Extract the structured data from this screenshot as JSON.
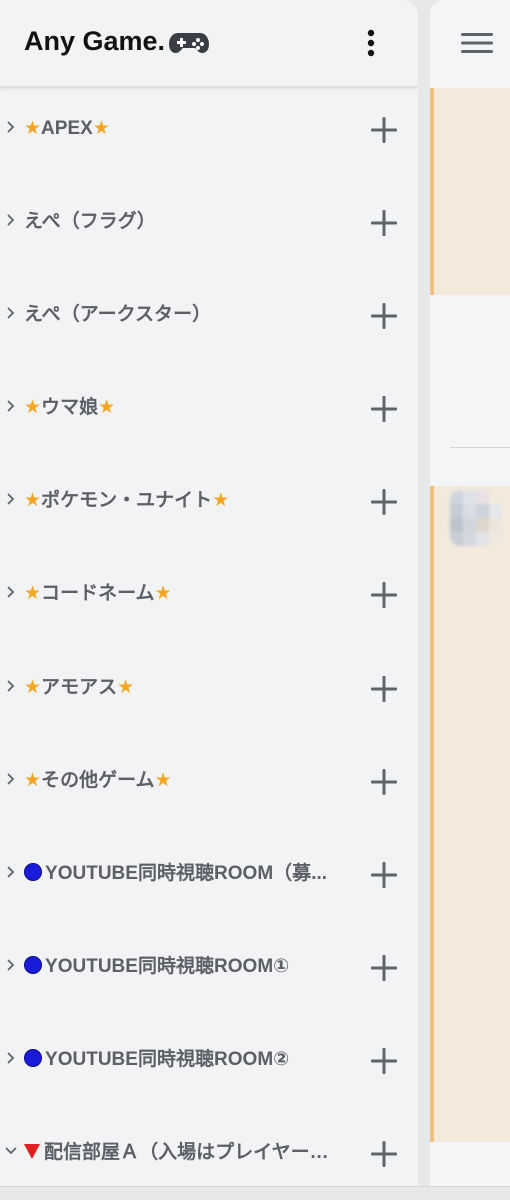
{
  "server": {
    "name": "Any Game."
  },
  "categories": [
    {
      "label": "★APEX★",
      "collapsed": true
    },
    {
      "label": "えぺ（フラグ）",
      "collapsed": true
    },
    {
      "label": "えぺ（アークスター）",
      "collapsed": true
    },
    {
      "label": "★ウマ娘★",
      "collapsed": true
    },
    {
      "label": "★ポケモン・ユナイト★",
      "collapsed": true
    },
    {
      "label": "★コードネーム★",
      "collapsed": true
    },
    {
      "label": "★アモアス★",
      "collapsed": true
    },
    {
      "label": "★その他ゲーム★",
      "collapsed": true
    },
    {
      "label": "🔵YOUTUBE同時視聴ROOM（募...",
      "collapsed": true
    },
    {
      "label": "🔵YOUTUBE同時視聴ROOM①",
      "collapsed": true
    },
    {
      "label": "🔵YOUTUBE同時視聴ROOM②",
      "collapsed": true
    },
    {
      "label": "🔻配信部屋Ａ（入場はプレイヤーの...",
      "collapsed": false
    }
  ],
  "icons": {
    "kebab": "kebab-menu-icon",
    "hamburger": "hamburger-menu-icon",
    "add": "plus-icon",
    "chevron_collapsed": "chevron-right-icon",
    "chevron_expanded": "chevron-down-icon",
    "gamepad": "gamepad-icon"
  },
  "colors": {
    "sidebar_bg": "#f2f3f5",
    "category_text": "#5c5f66",
    "star": "#f5a623",
    "blue_dot": "#1a1adb",
    "red_triangle": "#e02020",
    "highlight": "#f3eadb",
    "highlight_border": "#f2c07c"
  }
}
